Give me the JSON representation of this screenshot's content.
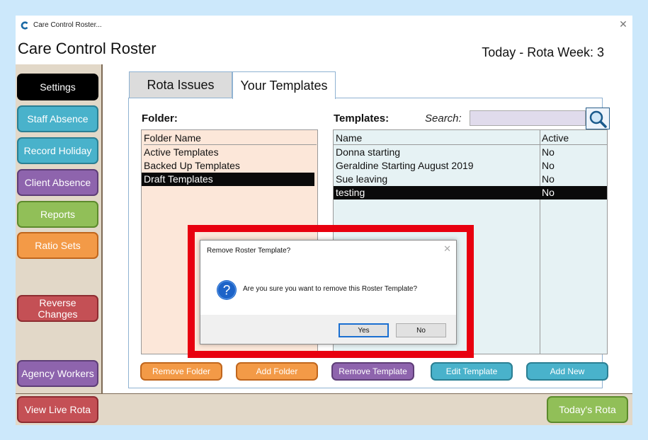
{
  "window": {
    "titlebar_text": "Care Control Roster...",
    "app_title": "Care Control Roster",
    "week_label": "Today - Rota Week: 3"
  },
  "sidebar": {
    "buttons": [
      {
        "label": "Settings",
        "color": "#000000"
      },
      {
        "label": "Staff Absence",
        "color": "#49b2cb"
      },
      {
        "label": "Record Holiday",
        "color": "#49b2cb"
      },
      {
        "label": "Client Absence",
        "color": "#8e64ad"
      },
      {
        "label": "Reports",
        "color": "#91bf58"
      },
      {
        "label": "Ratio Sets",
        "color": "#f39a47"
      },
      {
        "label": "Reverse Changes",
        "color": "#c45055"
      },
      {
        "label": "Agency Workers",
        "color": "#8e64ad"
      }
    ]
  },
  "bottom": {
    "view_live_rota": "View Live Rota",
    "todays_rota": "Today's Rota"
  },
  "tabs": [
    {
      "label": "Rota Issues",
      "active": false
    },
    {
      "label": "Your Templates",
      "active": true
    }
  ],
  "folders": {
    "label": "Folder:",
    "column_header": "Folder Name",
    "items": [
      "Active Templates",
      "Backed Up Templates",
      "Draft Templates"
    ],
    "selected_index": 2
  },
  "templates": {
    "label": "Templates:",
    "search_label": "Search:",
    "search_value": "",
    "columns": [
      "Name",
      "Active"
    ],
    "rows": [
      {
        "name": "Donna starting",
        "active": "No"
      },
      {
        "name": "Geraldine Starting August 2019",
        "active": "No"
      },
      {
        "name": "Sue leaving",
        "active": "No"
      },
      {
        "name": "testing",
        "active": "No"
      }
    ],
    "selected_index": 3
  },
  "actions": {
    "remove_folder": "Remove Folder",
    "add_folder": "Add Folder",
    "remove_template": "Remove Template",
    "edit_template": "Edit Template",
    "add_new": "Add New"
  },
  "dialog": {
    "title": "Remove Roster Template?",
    "icon": "question-icon",
    "message": "Are you sure you want to remove this Roster Template?",
    "yes_label": "Yes",
    "no_label": "No",
    "highlight_color": "#e8000f"
  }
}
